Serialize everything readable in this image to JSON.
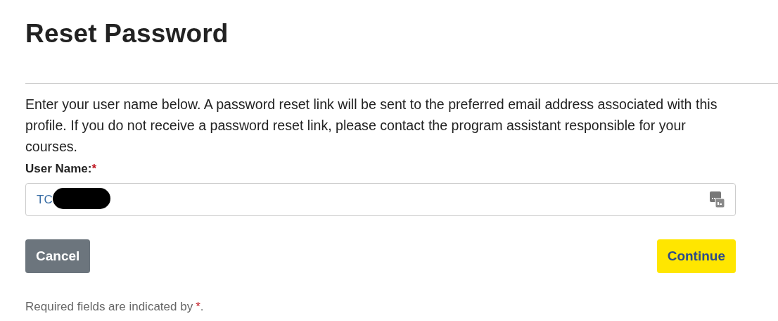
{
  "title": "Reset Password",
  "instructions": "Enter your user name below. A password reset link will be sent to the preferred email address associated with this profile. If you do not receive a password reset link, please contact the program assistant responsible for your courses.",
  "user_name": {
    "label": "User Name:",
    "required_mark": "*",
    "value": "TC"
  },
  "buttons": [
    {
      "label": "Cancel",
      "kind": "secondary"
    },
    {
      "label": "Continue",
      "kind": "primary"
    }
  ],
  "footnote": {
    "text": "Required fields are indicated by",
    "mark": "*",
    "end": "."
  }
}
